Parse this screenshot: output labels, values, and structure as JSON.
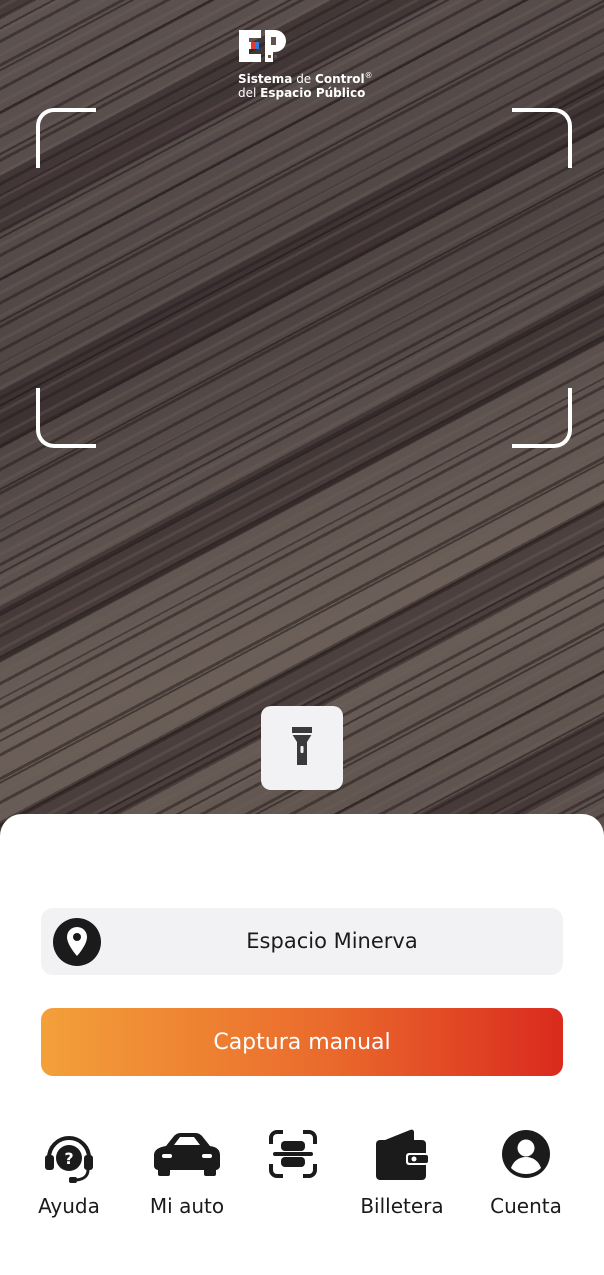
{
  "brand": {
    "line1_bold": "Sistema",
    "line1_light": " de ",
    "line1_bold2": "Control",
    "line1_mark": "®",
    "line2_light": "del ",
    "line2_bold": "Espacio Público"
  },
  "camera": {
    "flash_icon": "flashlight-icon"
  },
  "location": {
    "icon": "location-pin-icon",
    "label": "Espacio Minerva"
  },
  "capture": {
    "label": "Captura manual"
  },
  "nav": {
    "items": [
      {
        "label": "Ayuda",
        "icon": "headset-icon"
      },
      {
        "label": "Mi auto",
        "icon": "car-icon"
      },
      {
        "label": "",
        "icon": "scan-icon"
      },
      {
        "label": "Billetera",
        "icon": "wallet-icon"
      },
      {
        "label": "Cuenta",
        "icon": "account-icon"
      }
    ]
  },
  "colors": {
    "capture_gradient_start": "#f3a03a",
    "capture_gradient_end": "#da2a1e",
    "sheet_background": "#ffffff",
    "field_background": "#f2f2f4",
    "icon_color": "#1b1b1b"
  }
}
